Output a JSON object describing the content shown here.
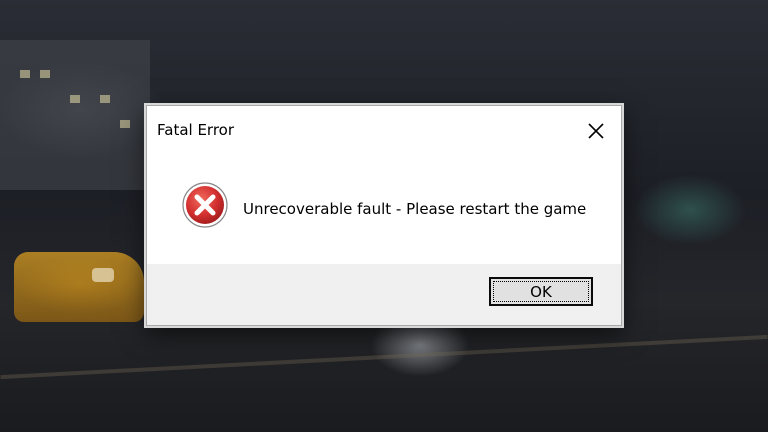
{
  "dialog": {
    "title": "Fatal Error",
    "message": "Unrecoverable fault - Please restart the game",
    "icon": "error-x-icon",
    "close_icon": "close-icon",
    "ok_label": "OK"
  },
  "colors": {
    "error_red": "#c62828",
    "dialog_bg": "#ffffff",
    "footer_bg": "#f0f0f0",
    "button_bg": "#e1e1e1"
  }
}
